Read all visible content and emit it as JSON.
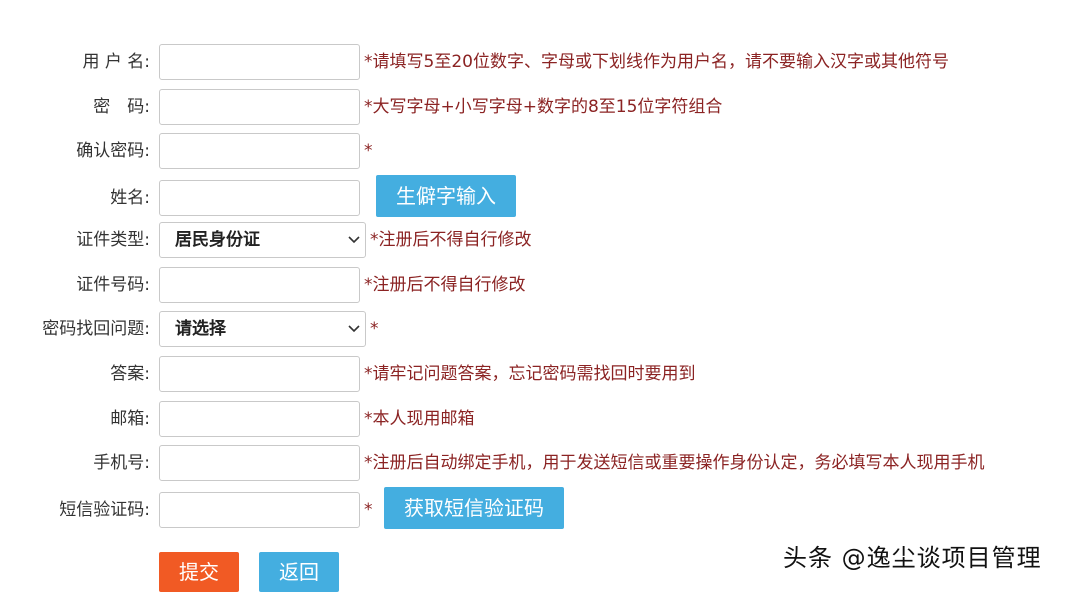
{
  "form": {
    "username": {
      "label": "用 户 名:",
      "value": "",
      "hint": "*请填写5至20位数字、字母或下划线作为用户名，请不要输入汉字或其他符号"
    },
    "password": {
      "label": "密　码:",
      "value": "",
      "hint": "*大写字母+小写字母+数字的8至15位字符组合"
    },
    "confirm_password": {
      "label": "确认密码:",
      "value": "",
      "hint": "*"
    },
    "name": {
      "label": "姓名:",
      "value": "",
      "button": "生僻字输入"
    },
    "id_type": {
      "label": "证件类型:",
      "selected": "居民身份证",
      "hint": "*注册后不得自行修改"
    },
    "id_number": {
      "label": "证件号码:",
      "value": "",
      "hint": "*注册后不得自行修改"
    },
    "security_question": {
      "label": "密码找回问题:",
      "selected": "请选择",
      "hint": "*"
    },
    "answer": {
      "label": "答案:",
      "value": "",
      "hint": "*请牢记问题答案，忘记密码需找回时要用到"
    },
    "email": {
      "label": "邮箱:",
      "value": "",
      "hint": "*本人现用邮箱"
    },
    "phone": {
      "label": "手机号:",
      "value": "",
      "hint": "*注册后自动绑定手机，用于发送短信或重要操作身份认定，务必填写本人现用手机"
    },
    "sms_code": {
      "label": "短信验证码:",
      "value": "",
      "hint": "*",
      "button": "获取短信验证码"
    }
  },
  "actions": {
    "submit": "提交",
    "back": "返回"
  },
  "watermark": "头条 @逸尘谈项目管理",
  "colors": {
    "hint": "#8b2323",
    "accent_blue": "#44aee0",
    "submit_orange": "#f15a24"
  }
}
